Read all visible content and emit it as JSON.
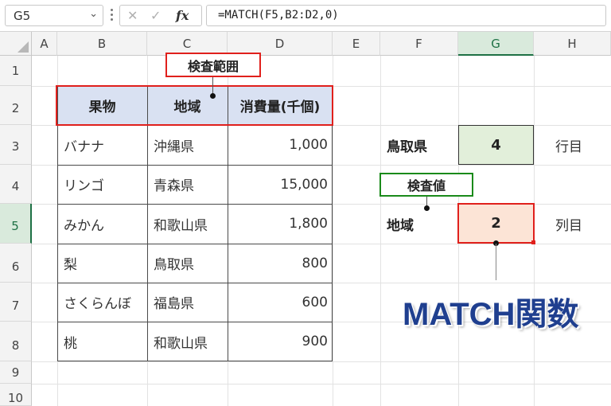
{
  "formula_bar": {
    "name_box": "G5",
    "formula": "=MATCH(F5,B2:D2,0)",
    "fx_label": "fx",
    "cancel_glyph": "✕",
    "enter_glyph": "✓"
  },
  "columns": [
    "A",
    "B",
    "C",
    "D",
    "E",
    "F",
    "G",
    "H"
  ],
  "rows": [
    "1",
    "2",
    "3",
    "4",
    "5",
    "6",
    "7",
    "8",
    "9",
    "10"
  ],
  "selected_cell": {
    "column": "G",
    "row": "5"
  },
  "table": {
    "headers": [
      "果物",
      "地域",
      "消費量(千個)"
    ],
    "rows": [
      {
        "fruit": "バナナ",
        "region": "沖縄県",
        "amount": "1,000"
      },
      {
        "fruit": "リンゴ",
        "region": "青森県",
        "amount": "15,000"
      },
      {
        "fruit": "みかん",
        "region": "和歌山県",
        "amount": "1,800"
      },
      {
        "fruit": "梨",
        "region": "鳥取県",
        "amount": "800"
      },
      {
        "fruit": "さくらんぼ",
        "region": "福島県",
        "amount": "600"
      },
      {
        "fruit": "桃",
        "region": "和歌山県",
        "amount": "900"
      }
    ]
  },
  "side": {
    "row3_label": "鳥取県",
    "row3_value": "4",
    "row3_suffix": "行目",
    "row5_label": "地域",
    "row5_value": "2",
    "row5_suffix": "列目"
  },
  "callouts": {
    "lookup_range": "検査範囲",
    "lookup_value": "検査値"
  },
  "title": "MATCH関数",
  "colors": {
    "header_fill": "#d9e1f2",
    "result_green": "#e2efda",
    "result_red": "#fce4d6",
    "callout_red": "#e0201c",
    "callout_green": "#1a8a1a",
    "title_blue": "#1f3f8f",
    "selection_green": "#1e7145"
  }
}
